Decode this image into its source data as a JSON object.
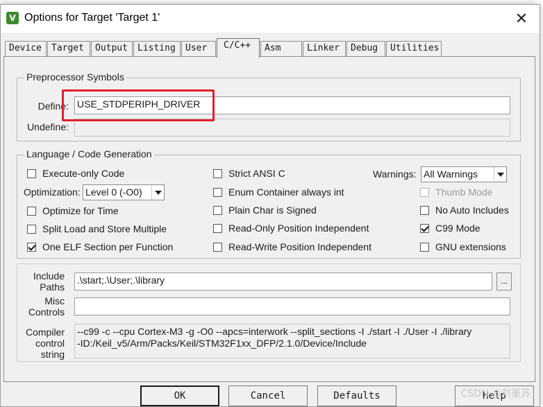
{
  "window": {
    "title": "Options for Target 'Target 1'",
    "icon_name": "keil-uvision-icon",
    "close_glyph": "✕"
  },
  "tabs": [
    {
      "label": "Device",
      "active": false
    },
    {
      "label": "Target",
      "active": false
    },
    {
      "label": "Output",
      "active": false
    },
    {
      "label": "Listing",
      "active": false
    },
    {
      "label": "User",
      "active": false
    },
    {
      "label": "C/C++",
      "active": true
    },
    {
      "label": "Asm",
      "active": false
    },
    {
      "label": "Linker",
      "active": false
    },
    {
      "label": "Debug",
      "active": false
    },
    {
      "label": "Utilities",
      "active": false
    }
  ],
  "preprocessor": {
    "group_title": "Preprocessor Symbols",
    "define_label": "Define:",
    "define_value": "USE_STDPERIPH_DRIVER",
    "undefine_label": "Undefine:",
    "undefine_value": ""
  },
  "language": {
    "group_title": "Language / Code Generation",
    "execute_only": {
      "label": "Execute-only Code",
      "checked": false
    },
    "optimization_label": "Optimization:",
    "optimization_value": "Level 0 (-O0)",
    "optimize_for_time": {
      "label": "Optimize for Time",
      "checked": false
    },
    "split_load_store": {
      "label": "Split Load and Store Multiple",
      "checked": false
    },
    "one_elf_section": {
      "label": "One ELF Section per Function",
      "checked": true
    },
    "strict_ansi": {
      "label": "Strict ANSI C",
      "checked": false
    },
    "enum_container": {
      "label": "Enum Container always int",
      "checked": false
    },
    "plain_char_signed": {
      "label": "Plain Char is Signed",
      "checked": false
    },
    "ro_position_independent": {
      "label": "Read-Only Position Independent",
      "checked": false
    },
    "rw_position_independent": {
      "label": "Read-Write Position Independent",
      "checked": false
    },
    "warnings_label": "Warnings:",
    "warnings_value": "All Warnings",
    "thumb_mode": {
      "label": "Thumb Mode",
      "checked": false,
      "disabled": true
    },
    "no_auto_includes": {
      "label": "No Auto Includes",
      "checked": false
    },
    "c99_mode": {
      "label": "C99 Mode",
      "checked": true
    },
    "gnu_extensions": {
      "label": "GNU extensions",
      "checked": false
    }
  },
  "paths": {
    "include_label_1": "Include",
    "include_label_2": "Paths",
    "include_value": ".\\start;.\\User;.\\library",
    "browse_label": "...",
    "misc_label_1": "Misc",
    "misc_label_2": "Controls",
    "misc_value": "",
    "compiler_label_1": "Compiler",
    "compiler_label_2": "control",
    "compiler_label_3": "string",
    "compiler_value": "--c99 -c --cpu Cortex-M3 -g -O0 --apcs=interwork --split_sections -I ./start -I ./User -I ./library\n-ID:/Keil_v5/Arm/Packs/Keil/STM32F1xx_DFP/2.1.0/Device/Include"
  },
  "buttons": {
    "ok": "OK",
    "cancel": "Cancel",
    "defaults": "Defaults",
    "help": "Help"
  },
  "watermark": "CSDN @刘墨苏",
  "colors": {
    "highlight": "#e0202a",
    "icon_green": "#3c8a2e"
  }
}
